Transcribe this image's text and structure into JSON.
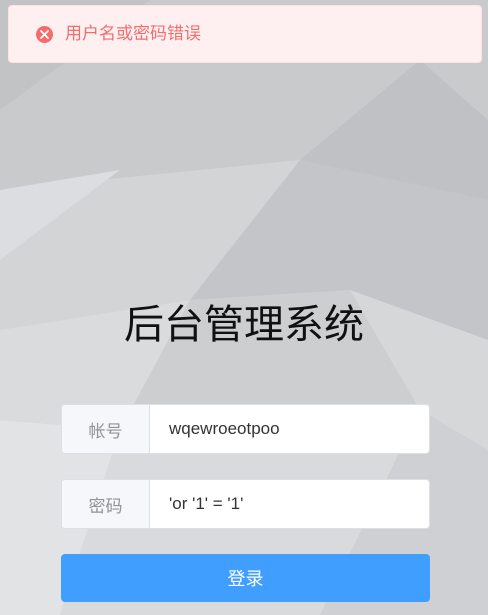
{
  "alert": {
    "type": "error",
    "icon": "close-circle-icon",
    "message": "用户名或密码错误",
    "color": "#f56c6c"
  },
  "page": {
    "title": "后台管理系统"
  },
  "form": {
    "account": {
      "label": "帐号",
      "value": "wqewroeotpoo"
    },
    "password": {
      "label": "密码",
      "value": "'or '1' = '1'"
    },
    "submit_label": "登录",
    "accent_color": "#409eff"
  }
}
